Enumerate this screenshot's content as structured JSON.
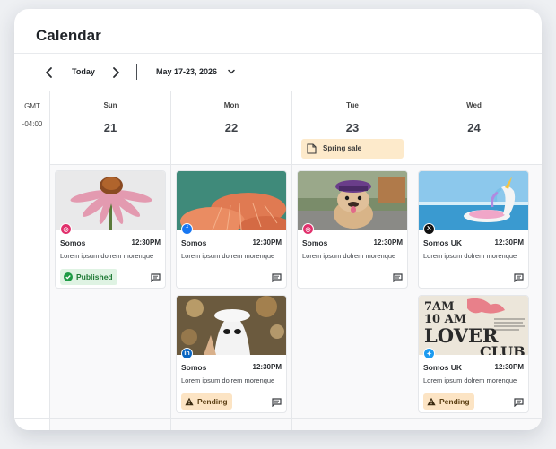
{
  "app": {
    "title": "Calendar"
  },
  "toolbar": {
    "prev_label": "‹",
    "today_label": "Today",
    "next_label": "›",
    "date_range": "May 17-23, 2026"
  },
  "timezone": {
    "line1": "GMT",
    "line2": "-04:00"
  },
  "days": [
    {
      "name": "Sun",
      "number": "21"
    },
    {
      "name": "Mon",
      "number": "22"
    },
    {
      "name": "Tue",
      "number": "23",
      "event": {
        "label": "Spring sale",
        "icon": "document-icon"
      }
    },
    {
      "name": "Wed",
      "number": "24"
    }
  ],
  "posts": [
    {
      "day": "Sun",
      "network": "instagram",
      "network_icon": "instagram-icon",
      "image": "pink coneflower",
      "account": "Somos",
      "time": "12:30PM",
      "text": "Lorem ipsum dolrem morenque",
      "status": "Published",
      "status_icon": "check-circle-icon"
    },
    {
      "day": "Mon",
      "network": "facebook",
      "network_icon": "facebook-icon",
      "image": "orange mushrooms",
      "account": "Somos",
      "time": "12:30PM",
      "text": "Lorem ipsum dolrem morenque"
    },
    {
      "day": "Mon",
      "network": "linkedin",
      "network_icon": "linkedin-icon",
      "image": "person in white ghost hat",
      "account": "Somos",
      "time": "12:30PM",
      "text": "Lorem ipsum dolrem morenque",
      "status": "Pending",
      "status_icon": "warning-icon"
    },
    {
      "day": "Tue",
      "network": "instagram",
      "network_icon": "instagram-icon",
      "image": "bulldog wearing purple cap",
      "account": "Somos",
      "time": "12:30PM",
      "text": "Lorem ipsum dolrem morenque"
    },
    {
      "day": "Wed",
      "network": "x",
      "network_icon": "x-icon",
      "image": "unicorn pool float",
      "account": "Somos UK",
      "time": "12:30PM",
      "text": "Lorem ipsum dolrem morenque"
    },
    {
      "day": "Wed",
      "network": "twitter",
      "network_icon": "twitter-bird-icon",
      "image": "lover club poster",
      "account": "Somos UK",
      "time": "12:30PM",
      "text": "Lorem ipsum dolrem morenque",
      "status": "Pending",
      "status_icon": "warning-icon"
    }
  ],
  "poster": {
    "line1": "7AM",
    "line2": "10 AM",
    "line3": "LOVER",
    "line4": "CLUB"
  },
  "colors": {
    "instagram": "#e1306c",
    "facebook": "#1877f2",
    "linkedin": "#0a66c2",
    "x": "#111111",
    "twitter": "#1d9bf0",
    "published_bg": "#dff3e3",
    "pending_bg": "#fce4c4",
    "event_bg": "#fdeacb"
  }
}
